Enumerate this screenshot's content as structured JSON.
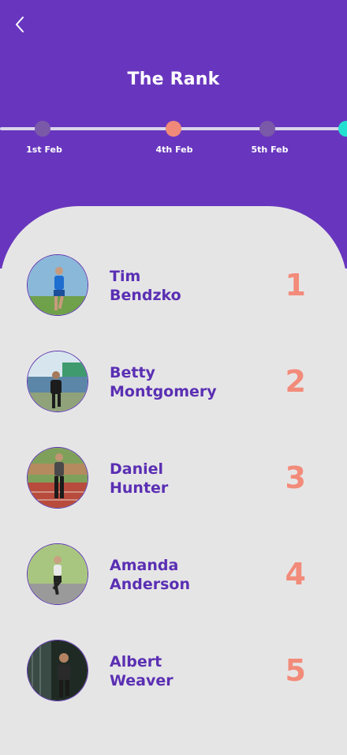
{
  "header": {
    "title": "The Rank",
    "background": "#6836be"
  },
  "timeline": {
    "dates": [
      {
        "label": "1st Feb",
        "state": "inactive"
      },
      {
        "label": "4th Feb",
        "state": "active"
      },
      {
        "label": "5th Feb",
        "state": "inactive"
      }
    ],
    "colors": {
      "active": "#f0897a",
      "inactive": "#7a5aa8",
      "next": "#25e0d0"
    }
  },
  "ranking": [
    {
      "first": "Tim",
      "last": "Bendzko",
      "rank": "1",
      "avatar": "runner-blue-photo"
    },
    {
      "first": "Betty",
      "last": "Montgomery",
      "rank": "2",
      "avatar": "runner-outdoor-photo"
    },
    {
      "first": "Daniel",
      "last": "Hunter",
      "rank": "3",
      "avatar": "runner-track-photo"
    },
    {
      "first": "Amanda",
      "last": "Anderson",
      "rank": "4",
      "avatar": "runner-road-photo"
    },
    {
      "first": "Albert",
      "last": "Weaver",
      "rank": "5",
      "avatar": "runner-dark-photo"
    }
  ],
  "colors": {
    "name": "#5a2fb3",
    "rank": "#f28b7a",
    "panel": "#e6e5e6"
  }
}
